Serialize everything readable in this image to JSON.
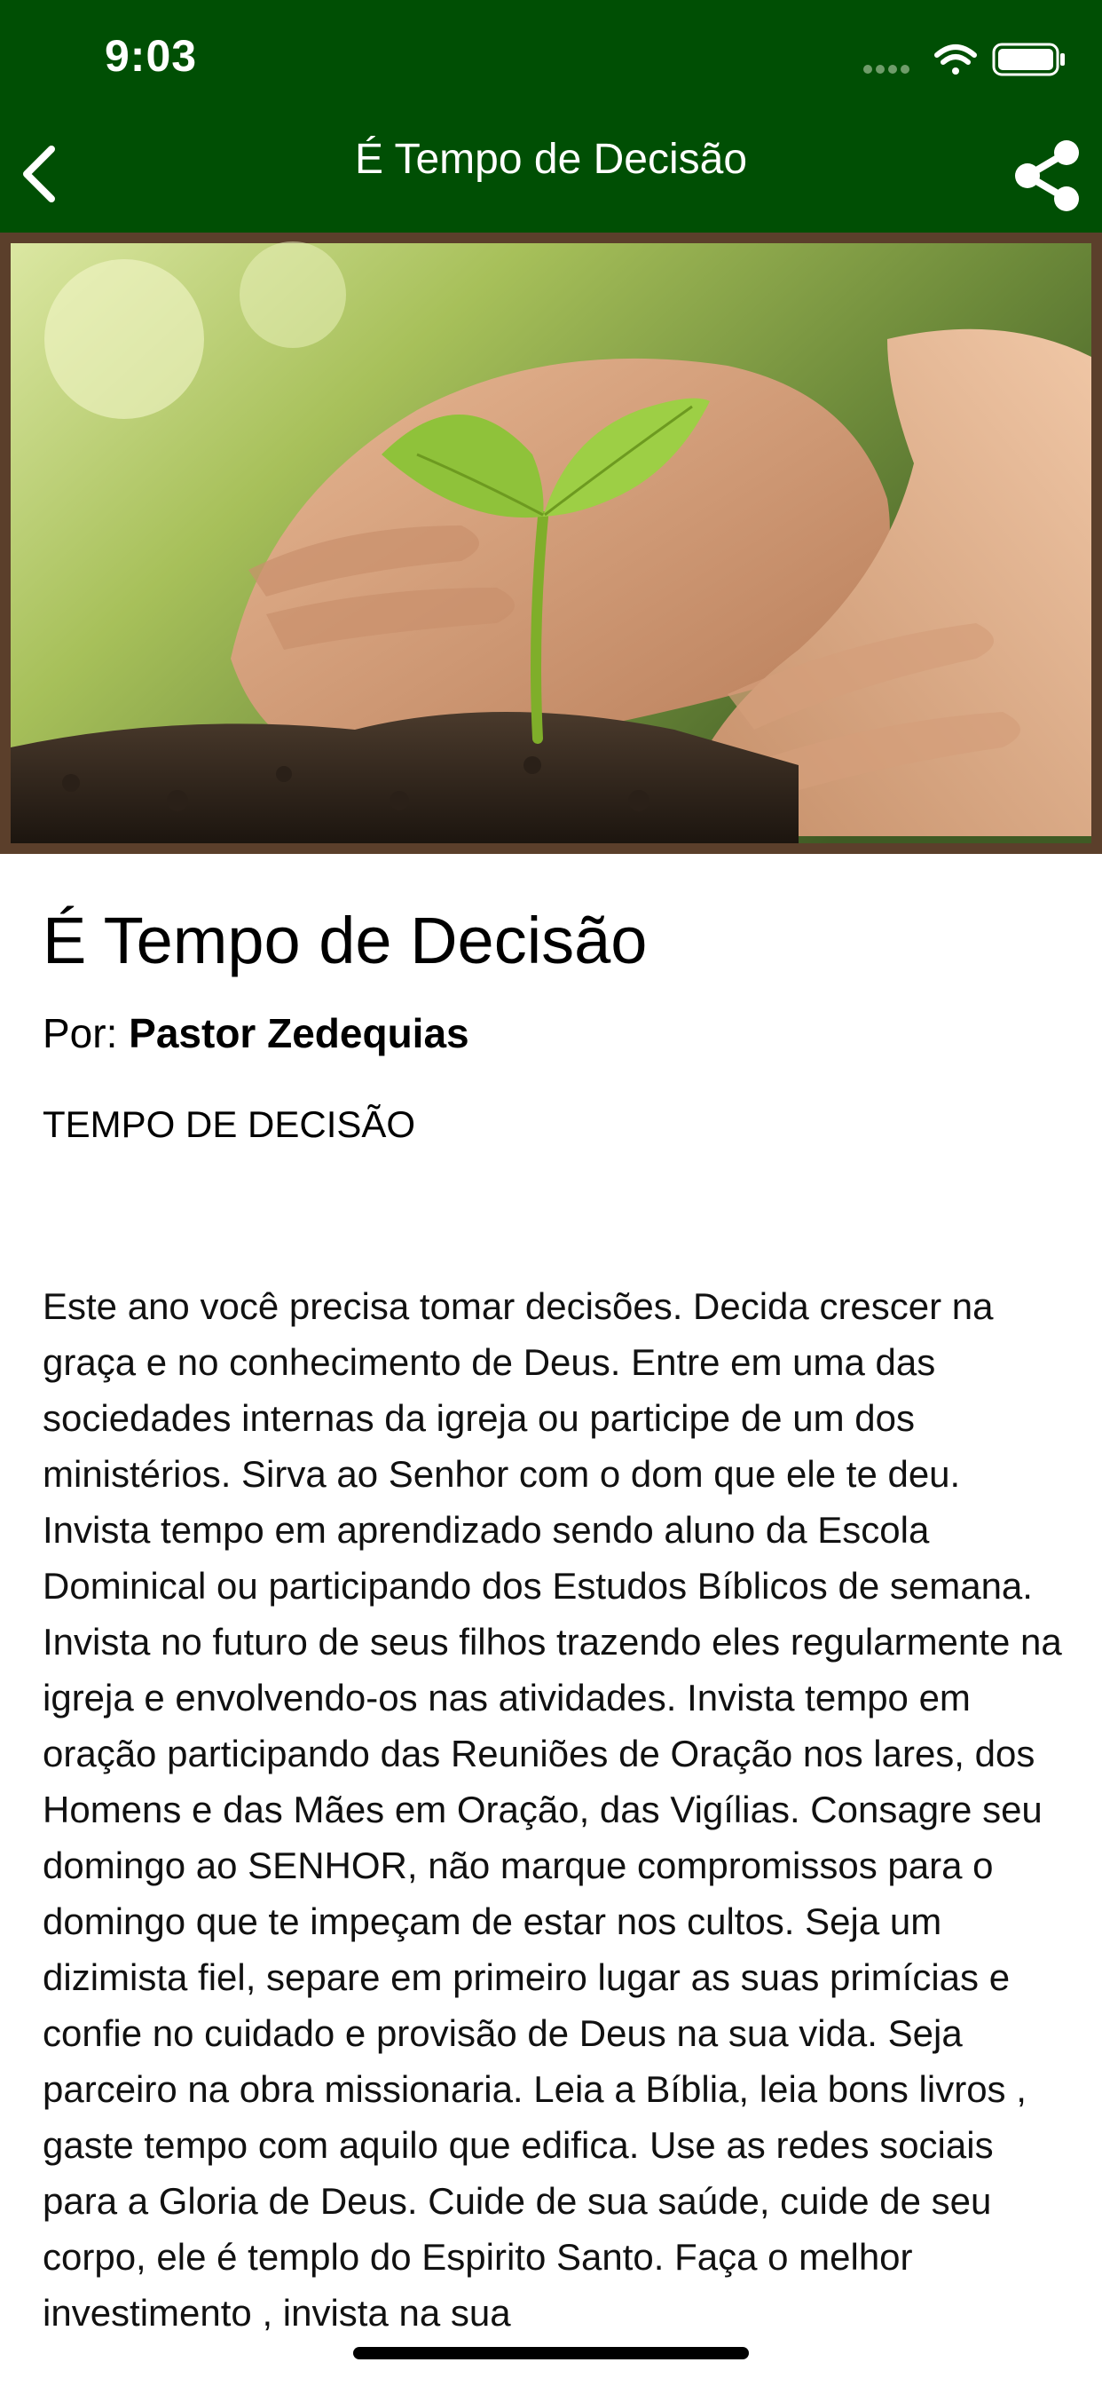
{
  "status_bar": {
    "time": "9:03",
    "icons": [
      "signal-icon",
      "wifi-icon",
      "battery-icon"
    ]
  },
  "nav_bar": {
    "title": "É Tempo de Decisão",
    "back_icon": "chevron-left-icon",
    "share_icon": "share-icon",
    "background": "#004f04"
  },
  "hero_image": {
    "description_icon": "seedling-hands-photo"
  },
  "article": {
    "title": "É Tempo de Decisão",
    "byline_prefix": "Por:",
    "author": "Pastor Zedequias",
    "subheading": "TEMPO DE DECISÃO",
    "body": "Este ano você precisa tomar decisões. Decida crescer na graça e no conhecimento de Deus. Entre em uma das sociedades internas da igreja ou participe de um dos ministérios. Sirva ao Senhor com o dom que ele te deu. Invista tempo em aprendizado sendo aluno da Escola Dominical ou participando dos Estudos Bíblicos de semana. Invista no futuro de seus filhos trazendo eles regularmente na igreja e envolvendo-os nas atividades. Invista tempo em oração participando das Reuniões de Oração nos lares, dos Homens e das Mães em Oração, das Vigílias. Consagre seu domingo ao SENHOR, não marque compromissos para o domingo que te impeçam de estar nos cultos. Seja um dizimista fiel, separe em primeiro lugar as suas primícias e confie no cuidado e provisão de Deus na sua vida. Seja parceiro na obra missionaria. Leia a Bíblia, leia bons livros , gaste tempo com aquilo que edifica. Use as redes sociais para a Gloria de Deus. Cuide de sua saúde, cuide de seu corpo, ele é templo do Espirito Santo. Faça o melhor investimento , invista na sua"
  }
}
